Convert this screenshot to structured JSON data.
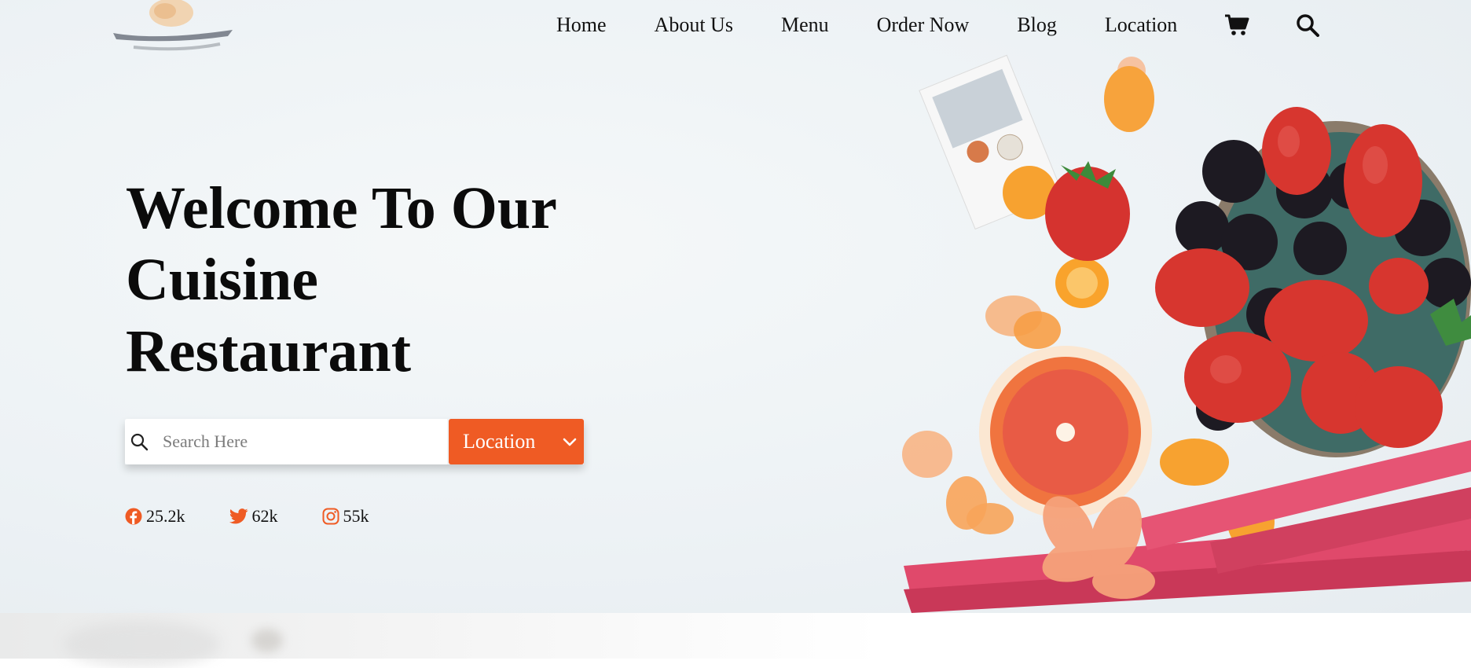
{
  "nav": {
    "items": [
      {
        "label": "Home"
      },
      {
        "label": "About Us"
      },
      {
        "label": "Menu"
      },
      {
        "label": "Order Now"
      },
      {
        "label": "Blog"
      },
      {
        "label": "Location"
      }
    ],
    "cart_icon": "cart-icon",
    "search_icon": "search-icon"
  },
  "hero": {
    "title_lines": [
      "Welcome To Our",
      "Cuisine",
      "Restaurant"
    ]
  },
  "search": {
    "placeholder": "Search Here",
    "value": "",
    "location_label": "Location",
    "dropdown_icon": "chevron-down-icon"
  },
  "social": {
    "facebook": {
      "count": "25.2k",
      "icon": "facebook-icon"
    },
    "twitter": {
      "count": "62k",
      "icon": "twitter-icon"
    },
    "instagram": {
      "count": "55k",
      "icon": "instagram-icon"
    }
  },
  "colors": {
    "accent": "#ef5b24",
    "text": "#111111",
    "hero_bg": "#edf2f5"
  }
}
